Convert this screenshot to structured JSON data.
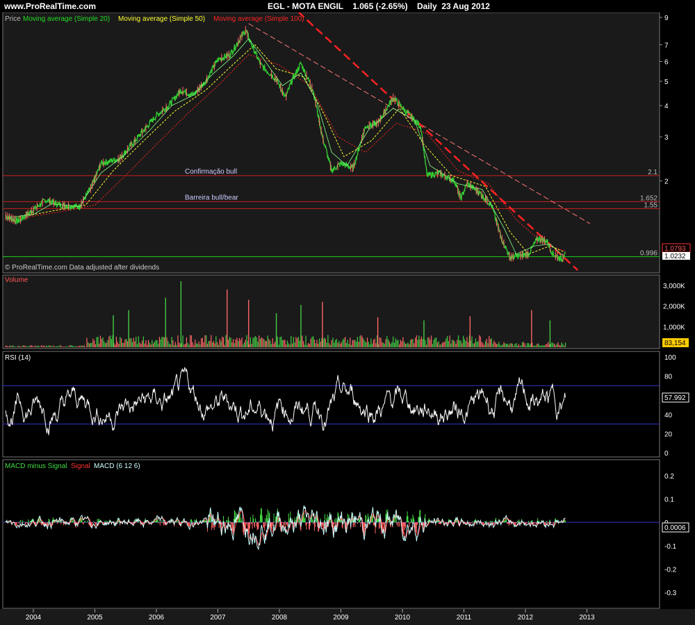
{
  "header": {
    "site": "www.ProRealTime.com",
    "instrument": "EGL - MOTA ENGIL",
    "price_change": "1.065 (-2.65%)",
    "period_date": "Daily  23 Aug 2012"
  },
  "colors": {
    "background": "#000000",
    "panel_bg": "#1a1a1a",
    "price_up": "#33cc33",
    "price_down": "#ff6666",
    "ma20": "#22dd22",
    "ma50": "#ffff33",
    "ma100": "#ff2222",
    "trendline": "#ff2222",
    "support_line": "#cc2222",
    "rsi_line": "#ffffff",
    "rsi_bands": "#3333cc",
    "macd_hist_pos": "#44dd44",
    "macd_hist_neg": "#ff6666",
    "signal": "#ff3333",
    "macd": "#ccffff"
  },
  "chart_data": [
    {
      "panel": "price",
      "type": "line",
      "legend": [
        "Price",
        "Moving average (Simple 20)",
        "Moving average (Simple 50)",
        "Moving average (Simple 100)"
      ],
      "note": "© ProRealTime.com  Data adjusted after dividends",
      "scale": "log",
      "y_ticks": [
        "9",
        "7",
        "6",
        "5",
        "4",
        "3",
        "2"
      ],
      "x_ticks": [
        "2004",
        "2005",
        "2006",
        "2007",
        "2008",
        "2009",
        "2010",
        "2011",
        "2012",
        "2013"
      ],
      "price_path": [
        {
          "x": 2003.55,
          "y": 1.45
        },
        {
          "x": 2003.75,
          "y": 1.38
        },
        {
          "x": 2003.95,
          "y": 1.5
        },
        {
          "x": 2004.2,
          "y": 1.68
        },
        {
          "x": 2004.45,
          "y": 1.6
        },
        {
          "x": 2004.75,
          "y": 1.58
        },
        {
          "x": 2004.95,
          "y": 1.9
        },
        {
          "x": 2005.1,
          "y": 2.35
        },
        {
          "x": 2005.4,
          "y": 2.45
        },
        {
          "x": 2005.6,
          "y": 2.8
        },
        {
          "x": 2005.85,
          "y": 3.3
        },
        {
          "x": 2006.0,
          "y": 3.65
        },
        {
          "x": 2006.2,
          "y": 4.0
        },
        {
          "x": 2006.4,
          "y": 4.6
        },
        {
          "x": 2006.6,
          "y": 4.4
        },
        {
          "x": 2006.8,
          "y": 5.0
        },
        {
          "x": 2007.0,
          "y": 6.1
        },
        {
          "x": 2007.2,
          "y": 6.4
        },
        {
          "x": 2007.45,
          "y": 8.0
        },
        {
          "x": 2007.55,
          "y": 7.0
        },
        {
          "x": 2007.7,
          "y": 5.8
        },
        {
          "x": 2007.95,
          "y": 5.1
        },
        {
          "x": 2008.1,
          "y": 4.3
        },
        {
          "x": 2008.2,
          "y": 5.0
        },
        {
          "x": 2008.35,
          "y": 5.9
        },
        {
          "x": 2008.55,
          "y": 4.6
        },
        {
          "x": 2008.7,
          "y": 3.0
        },
        {
          "x": 2008.85,
          "y": 2.2
        },
        {
          "x": 2009.0,
          "y": 2.35
        },
        {
          "x": 2009.2,
          "y": 2.25
        },
        {
          "x": 2009.4,
          "y": 3.3
        },
        {
          "x": 2009.6,
          "y": 3.4
        },
        {
          "x": 2009.85,
          "y": 4.3
        },
        {
          "x": 2010.05,
          "y": 3.8
        },
        {
          "x": 2010.3,
          "y": 3.3
        },
        {
          "x": 2010.4,
          "y": 2.1
        },
        {
          "x": 2010.6,
          "y": 2.15
        },
        {
          "x": 2010.85,
          "y": 2.0
        },
        {
          "x": 2010.95,
          "y": 1.7
        },
        {
          "x": 2011.05,
          "y": 1.95
        },
        {
          "x": 2011.25,
          "y": 1.8
        },
        {
          "x": 2011.45,
          "y": 1.6
        },
        {
          "x": 2011.6,
          "y": 1.2
        },
        {
          "x": 2011.75,
          "y": 0.99
        },
        {
          "x": 2011.95,
          "y": 1.01
        },
        {
          "x": 2012.05,
          "y": 1.02
        },
        {
          "x": 2012.2,
          "y": 1.18
        },
        {
          "x": 2012.35,
          "y": 1.15
        },
        {
          "x": 2012.45,
          "y": 1.02
        },
        {
          "x": 2012.6,
          "y": 0.97
        },
        {
          "x": 2012.65,
          "y": 1.065
        }
      ],
      "ma20_path": [
        {
          "x": 2003.6,
          "y": 1.43
        },
        {
          "x": 2004.0,
          "y": 1.47
        },
        {
          "x": 2004.3,
          "y": 1.62
        },
        {
          "x": 2004.75,
          "y": 1.58
        },
        {
          "x": 2005.1,
          "y": 2.15
        },
        {
          "x": 2005.45,
          "y": 2.5
        },
        {
          "x": 2005.9,
          "y": 3.2
        },
        {
          "x": 2006.25,
          "y": 4.0
        },
        {
          "x": 2006.6,
          "y": 4.4
        },
        {
          "x": 2006.9,
          "y": 5.3
        },
        {
          "x": 2007.25,
          "y": 6.3
        },
        {
          "x": 2007.5,
          "y": 7.4
        },
        {
          "x": 2007.75,
          "y": 6.1
        },
        {
          "x": 2008.05,
          "y": 4.8
        },
        {
          "x": 2008.35,
          "y": 5.4
        },
        {
          "x": 2008.6,
          "y": 4.2
        },
        {
          "x": 2008.85,
          "y": 2.6
        },
        {
          "x": 2009.1,
          "y": 2.3
        },
        {
          "x": 2009.45,
          "y": 3.2
        },
        {
          "x": 2009.85,
          "y": 3.9
        },
        {
          "x": 2010.2,
          "y": 3.5
        },
        {
          "x": 2010.45,
          "y": 2.3
        },
        {
          "x": 2010.9,
          "y": 1.95
        },
        {
          "x": 2011.3,
          "y": 1.85
        },
        {
          "x": 2011.65,
          "y": 1.3
        },
        {
          "x": 2011.85,
          "y": 1.02
        },
        {
          "x": 2012.15,
          "y": 1.1
        },
        {
          "x": 2012.4,
          "y": 1.12
        },
        {
          "x": 2012.62,
          "y": 1.0
        }
      ],
      "ma50_path": [
        {
          "x": 2003.7,
          "y": 1.42
        },
        {
          "x": 2004.2,
          "y": 1.5
        },
        {
          "x": 2004.85,
          "y": 1.6
        },
        {
          "x": 2005.3,
          "y": 2.2
        },
        {
          "x": 2005.8,
          "y": 2.9
        },
        {
          "x": 2006.3,
          "y": 3.8
        },
        {
          "x": 2006.8,
          "y": 4.6
        },
        {
          "x": 2007.3,
          "y": 6.0
        },
        {
          "x": 2007.6,
          "y": 7.0
        },
        {
          "x": 2007.95,
          "y": 5.6
        },
        {
          "x": 2008.4,
          "y": 5.2
        },
        {
          "x": 2008.75,
          "y": 3.6
        },
        {
          "x": 2009.05,
          "y": 2.5
        },
        {
          "x": 2009.5,
          "y": 2.9
        },
        {
          "x": 2009.95,
          "y": 3.9
        },
        {
          "x": 2010.35,
          "y": 2.8
        },
        {
          "x": 2010.8,
          "y": 2.1
        },
        {
          "x": 2011.35,
          "y": 1.9
        },
        {
          "x": 2011.75,
          "y": 1.25
        },
        {
          "x": 2012.05,
          "y": 1.02
        },
        {
          "x": 2012.4,
          "y": 1.1
        },
        {
          "x": 2012.63,
          "y": 1.04
        }
      ],
      "ma100_path": [
        {
          "x": 2003.8,
          "y": 1.42
        },
        {
          "x": 2004.4,
          "y": 1.5
        },
        {
          "x": 2005.0,
          "y": 1.6
        },
        {
          "x": 2005.5,
          "y": 2.1
        },
        {
          "x": 2006.0,
          "y": 2.8
        },
        {
          "x": 2006.5,
          "y": 3.7
        },
        {
          "x": 2007.0,
          "y": 4.8
        },
        {
          "x": 2007.5,
          "y": 6.4
        },
        {
          "x": 2008.0,
          "y": 5.8
        },
        {
          "x": 2008.5,
          "y": 4.8
        },
        {
          "x": 2008.95,
          "y": 3.0
        },
        {
          "x": 2009.4,
          "y": 2.6
        },
        {
          "x": 2009.9,
          "y": 3.4
        },
        {
          "x": 2010.4,
          "y": 3.1
        },
        {
          "x": 2010.9,
          "y": 2.2
        },
        {
          "x": 2011.4,
          "y": 1.95
        },
        {
          "x": 2011.85,
          "y": 1.4
        },
        {
          "x": 2012.3,
          "y": 1.12
        },
        {
          "x": 2012.64,
          "y": 1.05
        }
      ],
      "trend_thick": [
        {
          "x": 2008.3,
          "y": 9.5
        },
        {
          "x": 2012.85,
          "y": 0.88
        }
      ],
      "trend_thin": [
        {
          "x": 2007.5,
          "y": 8.5
        },
        {
          "x": 2013.05,
          "y": 1.35
        }
      ],
      "hlines": [
        {
          "value": 2.1,
          "label": "2.1",
          "text": "Confirmação bull"
        },
        {
          "value": 1.652,
          "label": "1.652",
          "text": "Barreira bull/bear"
        },
        {
          "value": 1.55,
          "label": "1.55",
          "text": ""
        },
        {
          "value": 0.996,
          "label": "0.996",
          "text": ""
        }
      ],
      "badges": [
        "1.0793",
        "1.0232"
      ]
    },
    {
      "panel": "volume",
      "type": "bar",
      "title": "Volume",
      "y_ticks": [
        "3,000K",
        "2,000K",
        "1,000K"
      ],
      "y_max": 3300,
      "last_badge": "83,154",
      "spikes": [
        {
          "x": 2006.4,
          "v": 3200
        },
        {
          "x": 2006.15,
          "v": 2400
        },
        {
          "x": 2007.15,
          "v": 2800
        },
        {
          "x": 2007.5,
          "v": 2300
        },
        {
          "x": 2008.7,
          "v": 2200
        },
        {
          "x": 2008.35,
          "v": 2050
        },
        {
          "x": 2011.1,
          "v": 1500
        },
        {
          "x": 2012.1,
          "v": 1800
        },
        {
          "x": 2012.4,
          "v": 1300
        },
        {
          "x": 2005.55,
          "v": 1800
        },
        {
          "x": 2005.3,
          "v": 1550
        },
        {
          "x": 2007.95,
          "v": 1650
        },
        {
          "x": 2009.6,
          "v": 1450
        },
        {
          "x": 2010.35,
          "v": 1300
        }
      ]
    },
    {
      "panel": "rsi",
      "type": "line",
      "title": "RSI (14)",
      "y_ticks": [
        "100",
        "80",
        "60",
        "40",
        "20",
        "0"
      ],
      "y_range": [
        0,
        100
      ],
      "bands": [
        70,
        30
      ],
      "last_badge": "57.992"
    },
    {
      "panel": "macd",
      "type": "line",
      "legend": [
        "MACD minus Signal",
        "Signal",
        "MACD (6 12 6)"
      ],
      "y_ticks": [
        "0.2",
        "0.1",
        "0",
        "-0.1",
        "-0.2",
        "-0.3"
      ],
      "y_range": [
        -0.35,
        0.25
      ],
      "last_badge": "0.0006"
    }
  ]
}
